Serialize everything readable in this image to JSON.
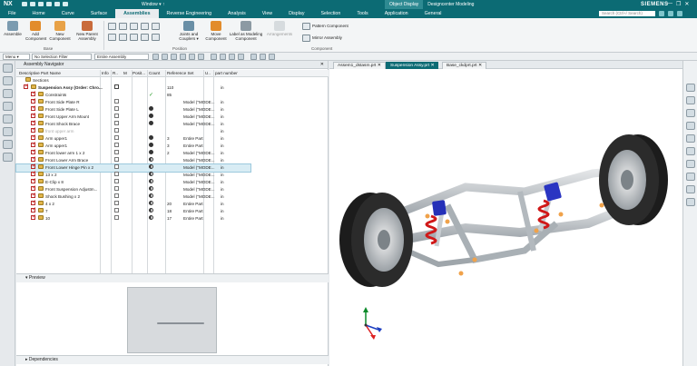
{
  "titlebar": {
    "logo": "NX",
    "window_menu": "Window ▾ ↑",
    "object_tab": "Object Display",
    "app_title": "Designcenter Modeling",
    "brand": "SIEMENS",
    "minimize": "—",
    "restore": "❐",
    "close": "✕"
  },
  "menu": {
    "tabs": [
      "File",
      "Home",
      "Curve",
      "Surface",
      "Assemblies",
      "Reverse Engineering",
      "Analysis",
      "View",
      "Display",
      "Selection",
      "Tools",
      "Application",
      "General"
    ],
    "active": "Assemblies",
    "search_placeholder": "Search (Ctrl+/ Search)"
  },
  "ribbon": {
    "buttons": [
      "Assemble",
      "Add Component",
      "New Component",
      "New Parent Assembly",
      "Move Component",
      "Joints and Couplers ▾",
      "Move Component",
      "Label as Modeling Component",
      "Arrangements"
    ],
    "small": [
      "Pattern Component",
      "Mirror Assembly"
    ],
    "groups": [
      "Base",
      "Position",
      "Component"
    ]
  },
  "toolbar2": {
    "menu": "Menu ▾",
    "filter": "No Selection Filter",
    "scope": "Entire Assembly"
  },
  "navigator": {
    "title": "Assembly Navigator",
    "columns": [
      "Descriptive Part Name",
      "Info",
      "R..",
      "M",
      "Posit...",
      "Count",
      "Reference Set",
      "U..",
      "part number"
    ],
    "rows": [
      {
        "name": "Sections",
        "count": "",
        "ref": "",
        "u": ""
      },
      {
        "name": "Suspension Assy (Order: Chro...",
        "count": "110",
        "ref": "",
        "u": "in"
      },
      {
        "name": "Constraints",
        "count": "85",
        "ref": "",
        "u": ""
      },
      {
        "name": "Front Side Plate R",
        "count": "",
        "ref": "Model (\"MODE...",
        "u": "in"
      },
      {
        "name": "Front Side Plate L",
        "count": "",
        "ref": "Model (\"MODE...",
        "u": "in"
      },
      {
        "name": "Front Upper Arm Mount",
        "count": "",
        "ref": "Model (\"MODE...",
        "u": "in"
      },
      {
        "name": "Front Shock Brace",
        "count": "",
        "ref": "Model (\"MODE...",
        "u": "in"
      },
      {
        "name": "front upper arm",
        "count": "",
        "ref": "",
        "u": "in"
      },
      {
        "name": "Arm upper1",
        "count": "3",
        "ref": "Entire Part",
        "u": "in"
      },
      {
        "name": "Arm upper1",
        "count": "3",
        "ref": "Entire Part",
        "u": "in"
      },
      {
        "name": "Front lower arm 1 x 2",
        "count": "2",
        "ref": "Model (\"MODE...",
        "u": "in"
      },
      {
        "name": "Front Lower Arm Brace",
        "count": "",
        "ref": "Model (\"MODE...",
        "u": "in"
      },
      {
        "name": "Front Lower Hinge Pin x 2",
        "count": "",
        "ref": "Model (\"MODE...",
        "u": "in"
      },
      {
        "name": "13 x 2",
        "count": "",
        "ref": "Model (\"MODE...",
        "u": "in"
      },
      {
        "name": "E-Clip x 8",
        "count": "",
        "ref": "Model (\"MODE...",
        "u": "in"
      },
      {
        "name": "Front Suspension Adjustm...",
        "count": "",
        "ref": "Model (\"MODE...",
        "u": "in"
      },
      {
        "name": "Shock Bushing x 2",
        "count": "",
        "ref": "Model (\"MODE...",
        "u": "in"
      },
      {
        "name": "4 x 2",
        "count": "20",
        "ref": "Entire Part",
        "u": "in"
      },
      {
        "name": "7",
        "count": "18",
        "ref": "Entire Part",
        "u": "in"
      },
      {
        "name": "10",
        "count": "17",
        "ref": "Entire Part",
        "u": "in"
      }
    ],
    "preview": "Preview",
    "dependencies": "Dependencies"
  },
  "files": [
    "Assem1_dstasm.prt",
    "Suspension Assy.prt",
    "Base_ckdprt.prt"
  ],
  "active_file": "Suspension Assy.prt",
  "colors": {
    "teal": "#0c6b74",
    "selection": "#d8ecf4"
  }
}
